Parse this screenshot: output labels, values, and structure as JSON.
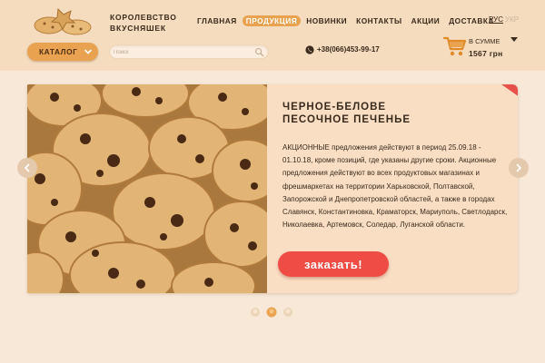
{
  "brand": {
    "line1": "КОРОЛЕВСТВО",
    "line2": "ВКУСНЯШЕК",
    "logo_icon": "cookies-logo-icon"
  },
  "nav": {
    "items": [
      {
        "label": "ГЛАВНАЯ",
        "active": false
      },
      {
        "label": "ПРОДУКЦИЯ",
        "active": true
      },
      {
        "label": "НОВИНКИ",
        "active": false
      },
      {
        "label": "КОНТАКТЫ",
        "active": false
      },
      {
        "label": "АКЦИИ",
        "active": false
      },
      {
        "label": "ДОСТАВКА",
        "active": false
      }
    ]
  },
  "lang": {
    "ru": "РУС",
    "ua": "УКР"
  },
  "catalog": {
    "label": "КАТАЛОГ",
    "icon": "chevron-down-icon"
  },
  "search": {
    "value": "",
    "placeholder": "Поиск",
    "icon": "search-icon"
  },
  "phone": {
    "number": "+38(066)453-99-17",
    "icon": "phone-icon"
  },
  "cart": {
    "label": "в сумме",
    "amount": "1567 грн",
    "icon": "cart-icon"
  },
  "slide": {
    "title_line1": "ЧЕРНОЕ-БЕЛОВЕ",
    "title_line2": "ПЕСОЧНОЕ ПЕЧЕНЬЕ",
    "text": "АКЦИОННЫЕ предложения действуют в период 25.09.18 - 01.10.18, кроме позиций, где указаны другие сроки. Акционные предложения действуют во всех продуктовых магазинах и фрешмаркетах  на территории Харьковской, Полтавской, Запорожской и Днепропетровской областей, а также в городах Славянск, Константиновка, Краматорск, Мариуполь, Светлодарск, Николаевка, Артемовск, Соледар, Луганской области.",
    "button": "заказать!",
    "image": "chocolate-chip-cookies-photo"
  },
  "slider": {
    "dots": 3,
    "active_dot": 2
  },
  "colors": {
    "accent": "#e8a250",
    "cta": "#ee4c44",
    "header_bg": "#f5dcbf",
    "page_bg": "#f7e8d8"
  }
}
